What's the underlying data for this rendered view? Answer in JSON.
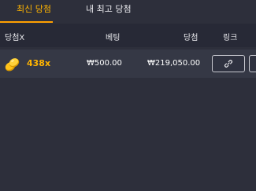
{
  "tabs": {
    "latest_wins": "최신 당첨",
    "my_best_wins": "내 최고 당첨"
  },
  "table": {
    "headers": {
      "multiplier": "당첨X",
      "bet": "베팅",
      "win": "당첨",
      "link": "링크"
    },
    "rows": [
      {
        "multiplier": "438x",
        "bet": "₩500.00",
        "win": "₩219,050.00",
        "icon": "gold-coins-icon"
      }
    ]
  },
  "colors": {
    "accent": "#ffb400",
    "background": "#2d2f3b",
    "header_background": "#272936",
    "row_background": "#353845"
  }
}
